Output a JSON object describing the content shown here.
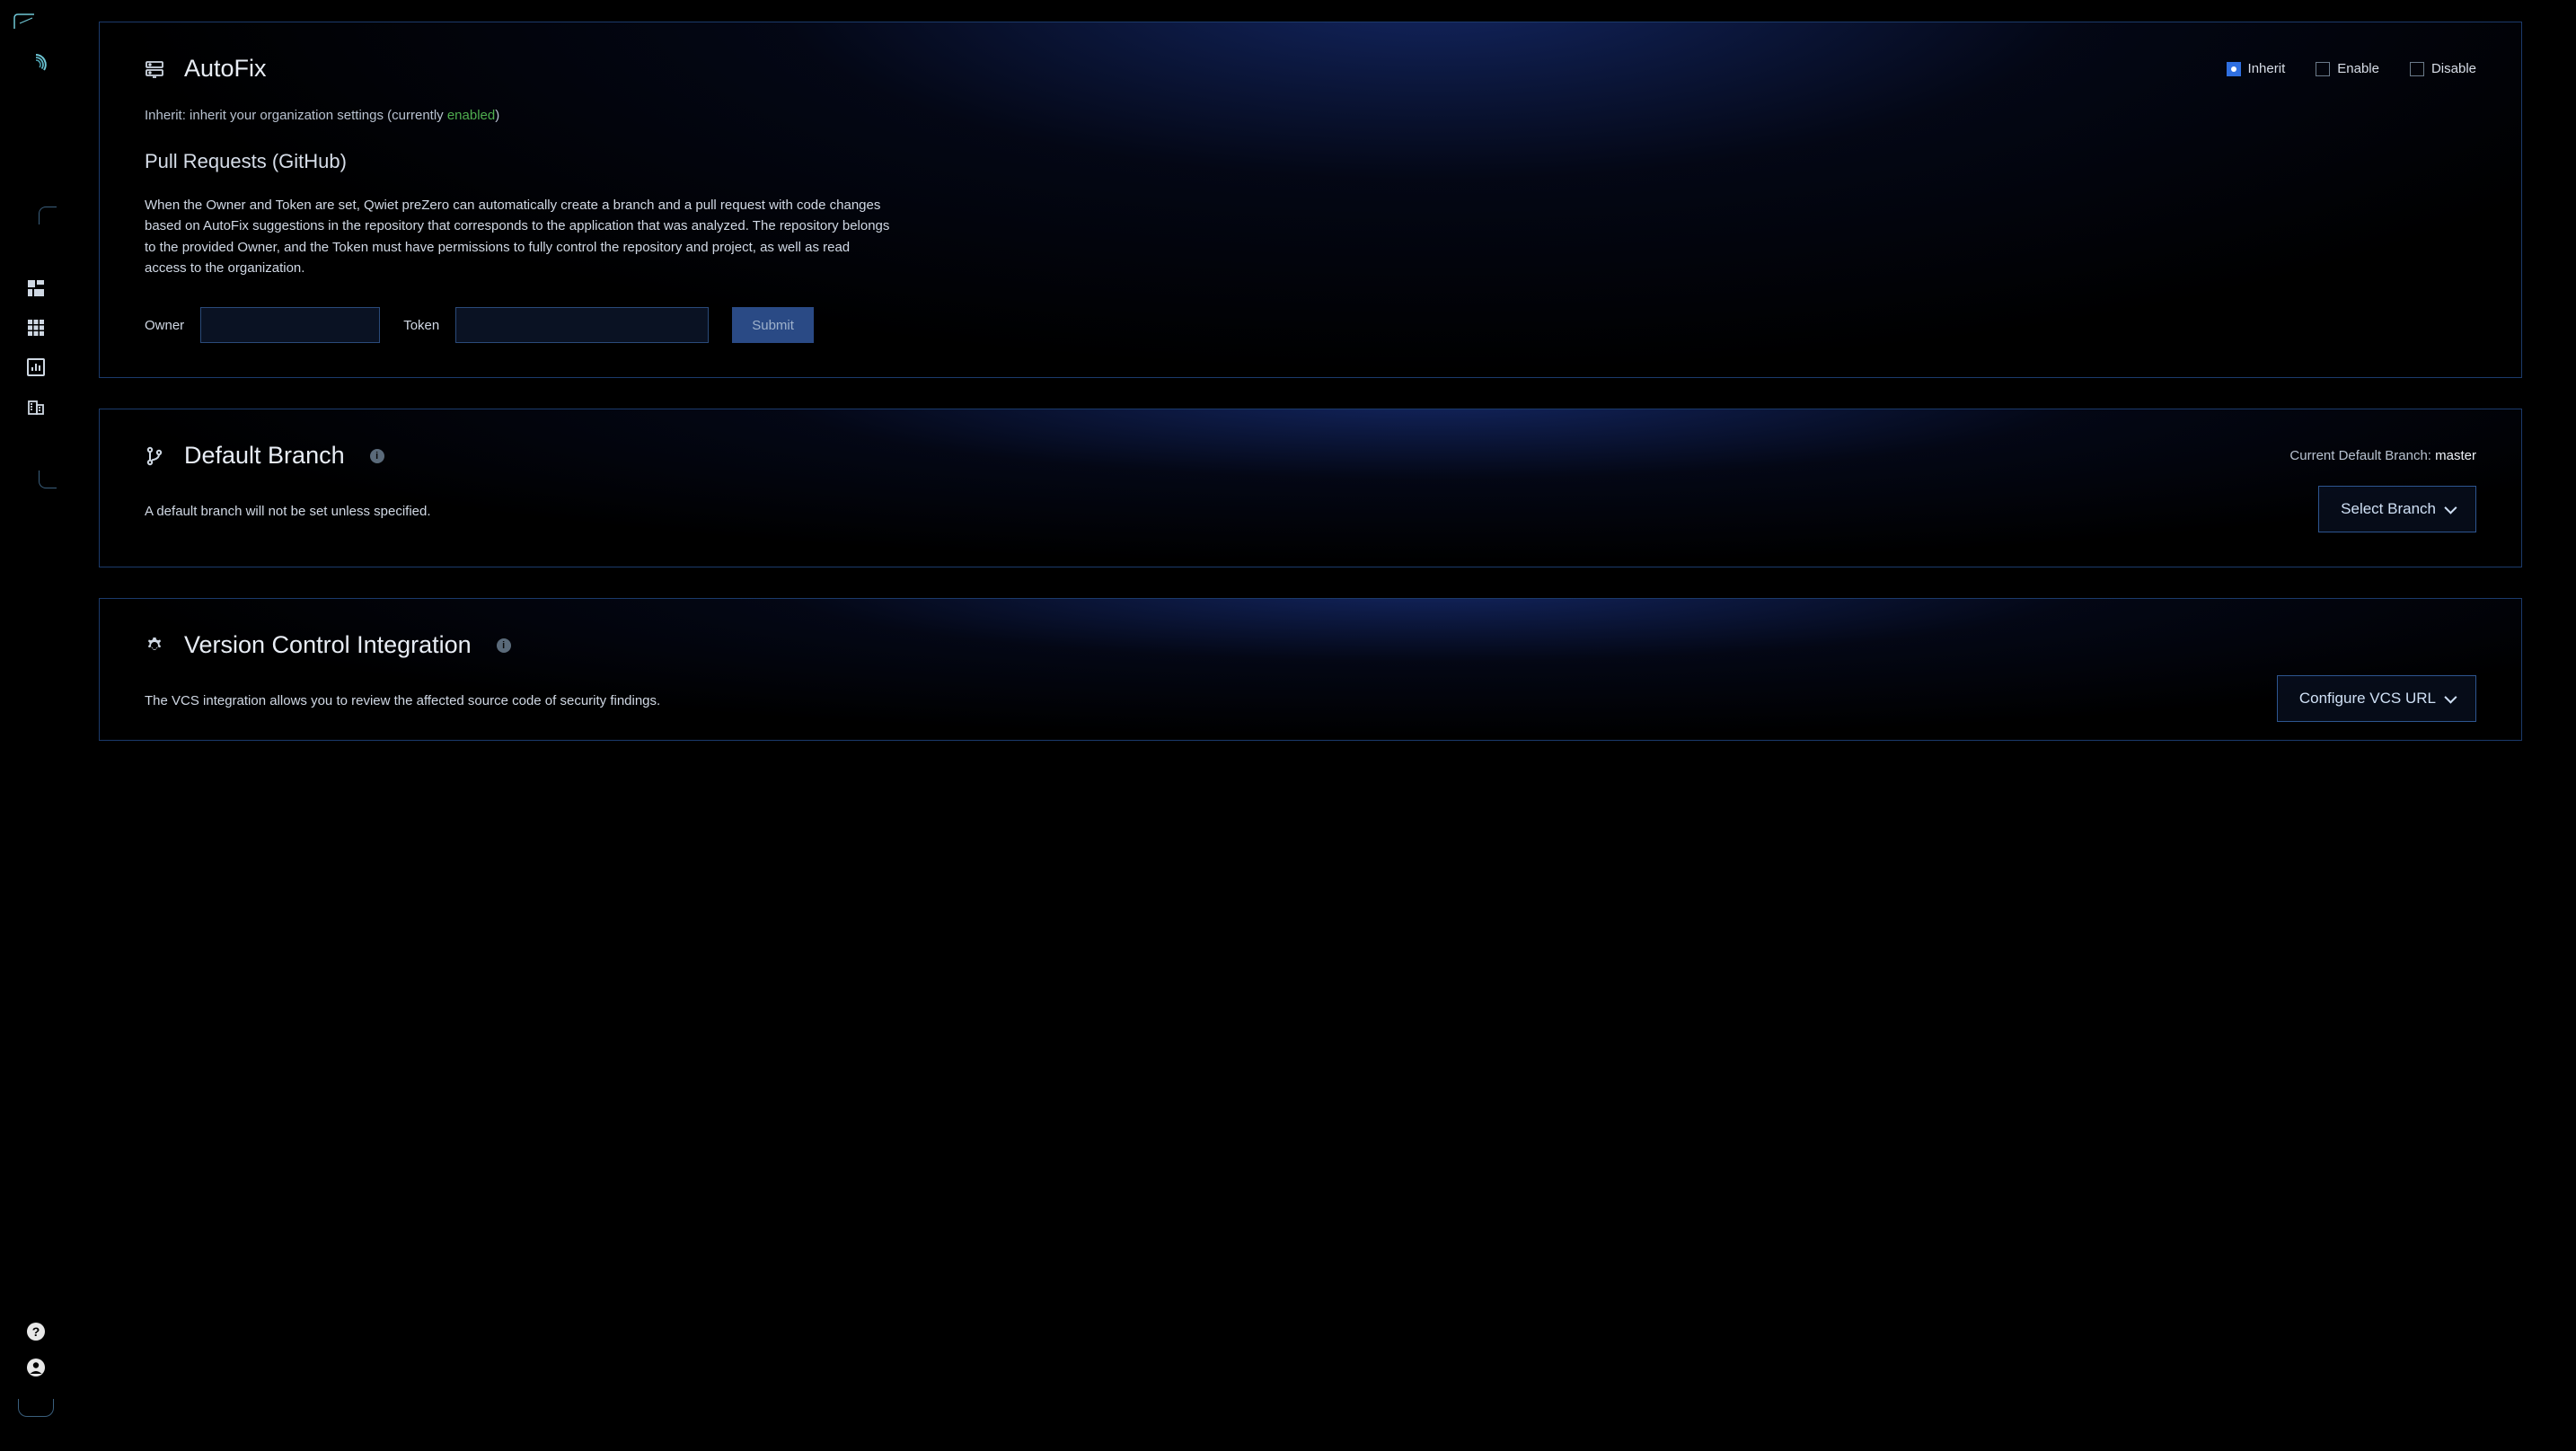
{
  "autofix": {
    "title": "AutoFix",
    "radios": {
      "inherit": "Inherit",
      "enable": "Enable",
      "disable": "Disable"
    },
    "inherit_prefix": "Inherit: inherit your organization settings (currently ",
    "inherit_status": "enabled",
    "inherit_suffix": ")",
    "subheading": "Pull Requests (GitHub)",
    "description": "When the Owner and Token are set, Qwiet preZero can automatically create a branch and a pull request with code changes based on AutoFix suggestions in the repository that corresponds to the application that was analyzed. The repository belongs to the provided Owner, and the Token must have permissions to fully control the repository and project, as well as read access to the organization.",
    "owner_label": "Owner",
    "token_label": "Token",
    "submit_label": "Submit"
  },
  "default_branch": {
    "title": "Default Branch",
    "current_label": "Current Default Branch: ",
    "current_value": "master",
    "description": "A default branch will not be set unless specified.",
    "select_label": "Select Branch"
  },
  "vcs": {
    "title": "Version Control Integration",
    "description": "The VCS integration allows you to review the affected source code of security findings.",
    "configure_label": "Configure VCS URL"
  }
}
